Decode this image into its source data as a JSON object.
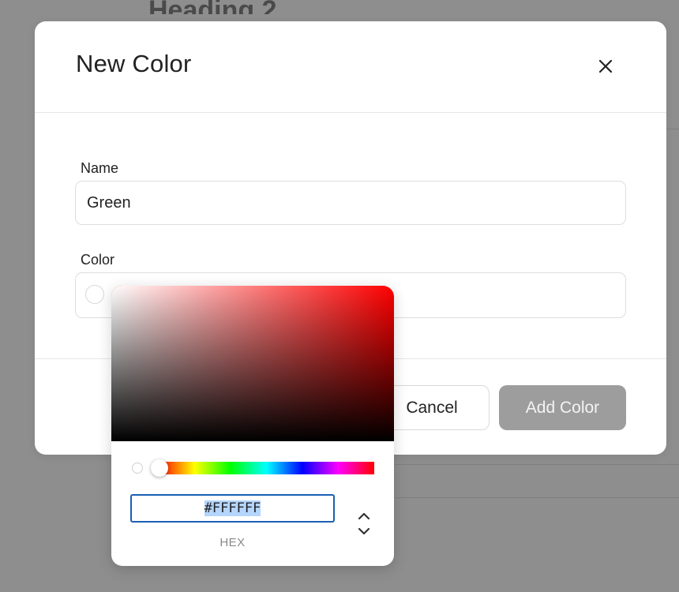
{
  "background": {
    "heading": "Heading 2"
  },
  "dialog": {
    "title": "New Color",
    "close_icon": "close-icon",
    "name_label": "Name",
    "name_value": "Green",
    "color_label": "Color",
    "cancel_label": "Cancel",
    "submit_label": "Add Color",
    "submit_color": "#9d9d9d"
  },
  "picker": {
    "hue_colors": [
      "#ff0000",
      "#ffff00",
      "#00ff00",
      "#00ffff",
      "#0000ff",
      "#ff00ff",
      "#ff0000"
    ],
    "base_hue_color": "#ff0000",
    "hex_value": "#FFFFFF",
    "hex_label": "HEX",
    "toggle_icon": "chevron-up-down-icon"
  }
}
